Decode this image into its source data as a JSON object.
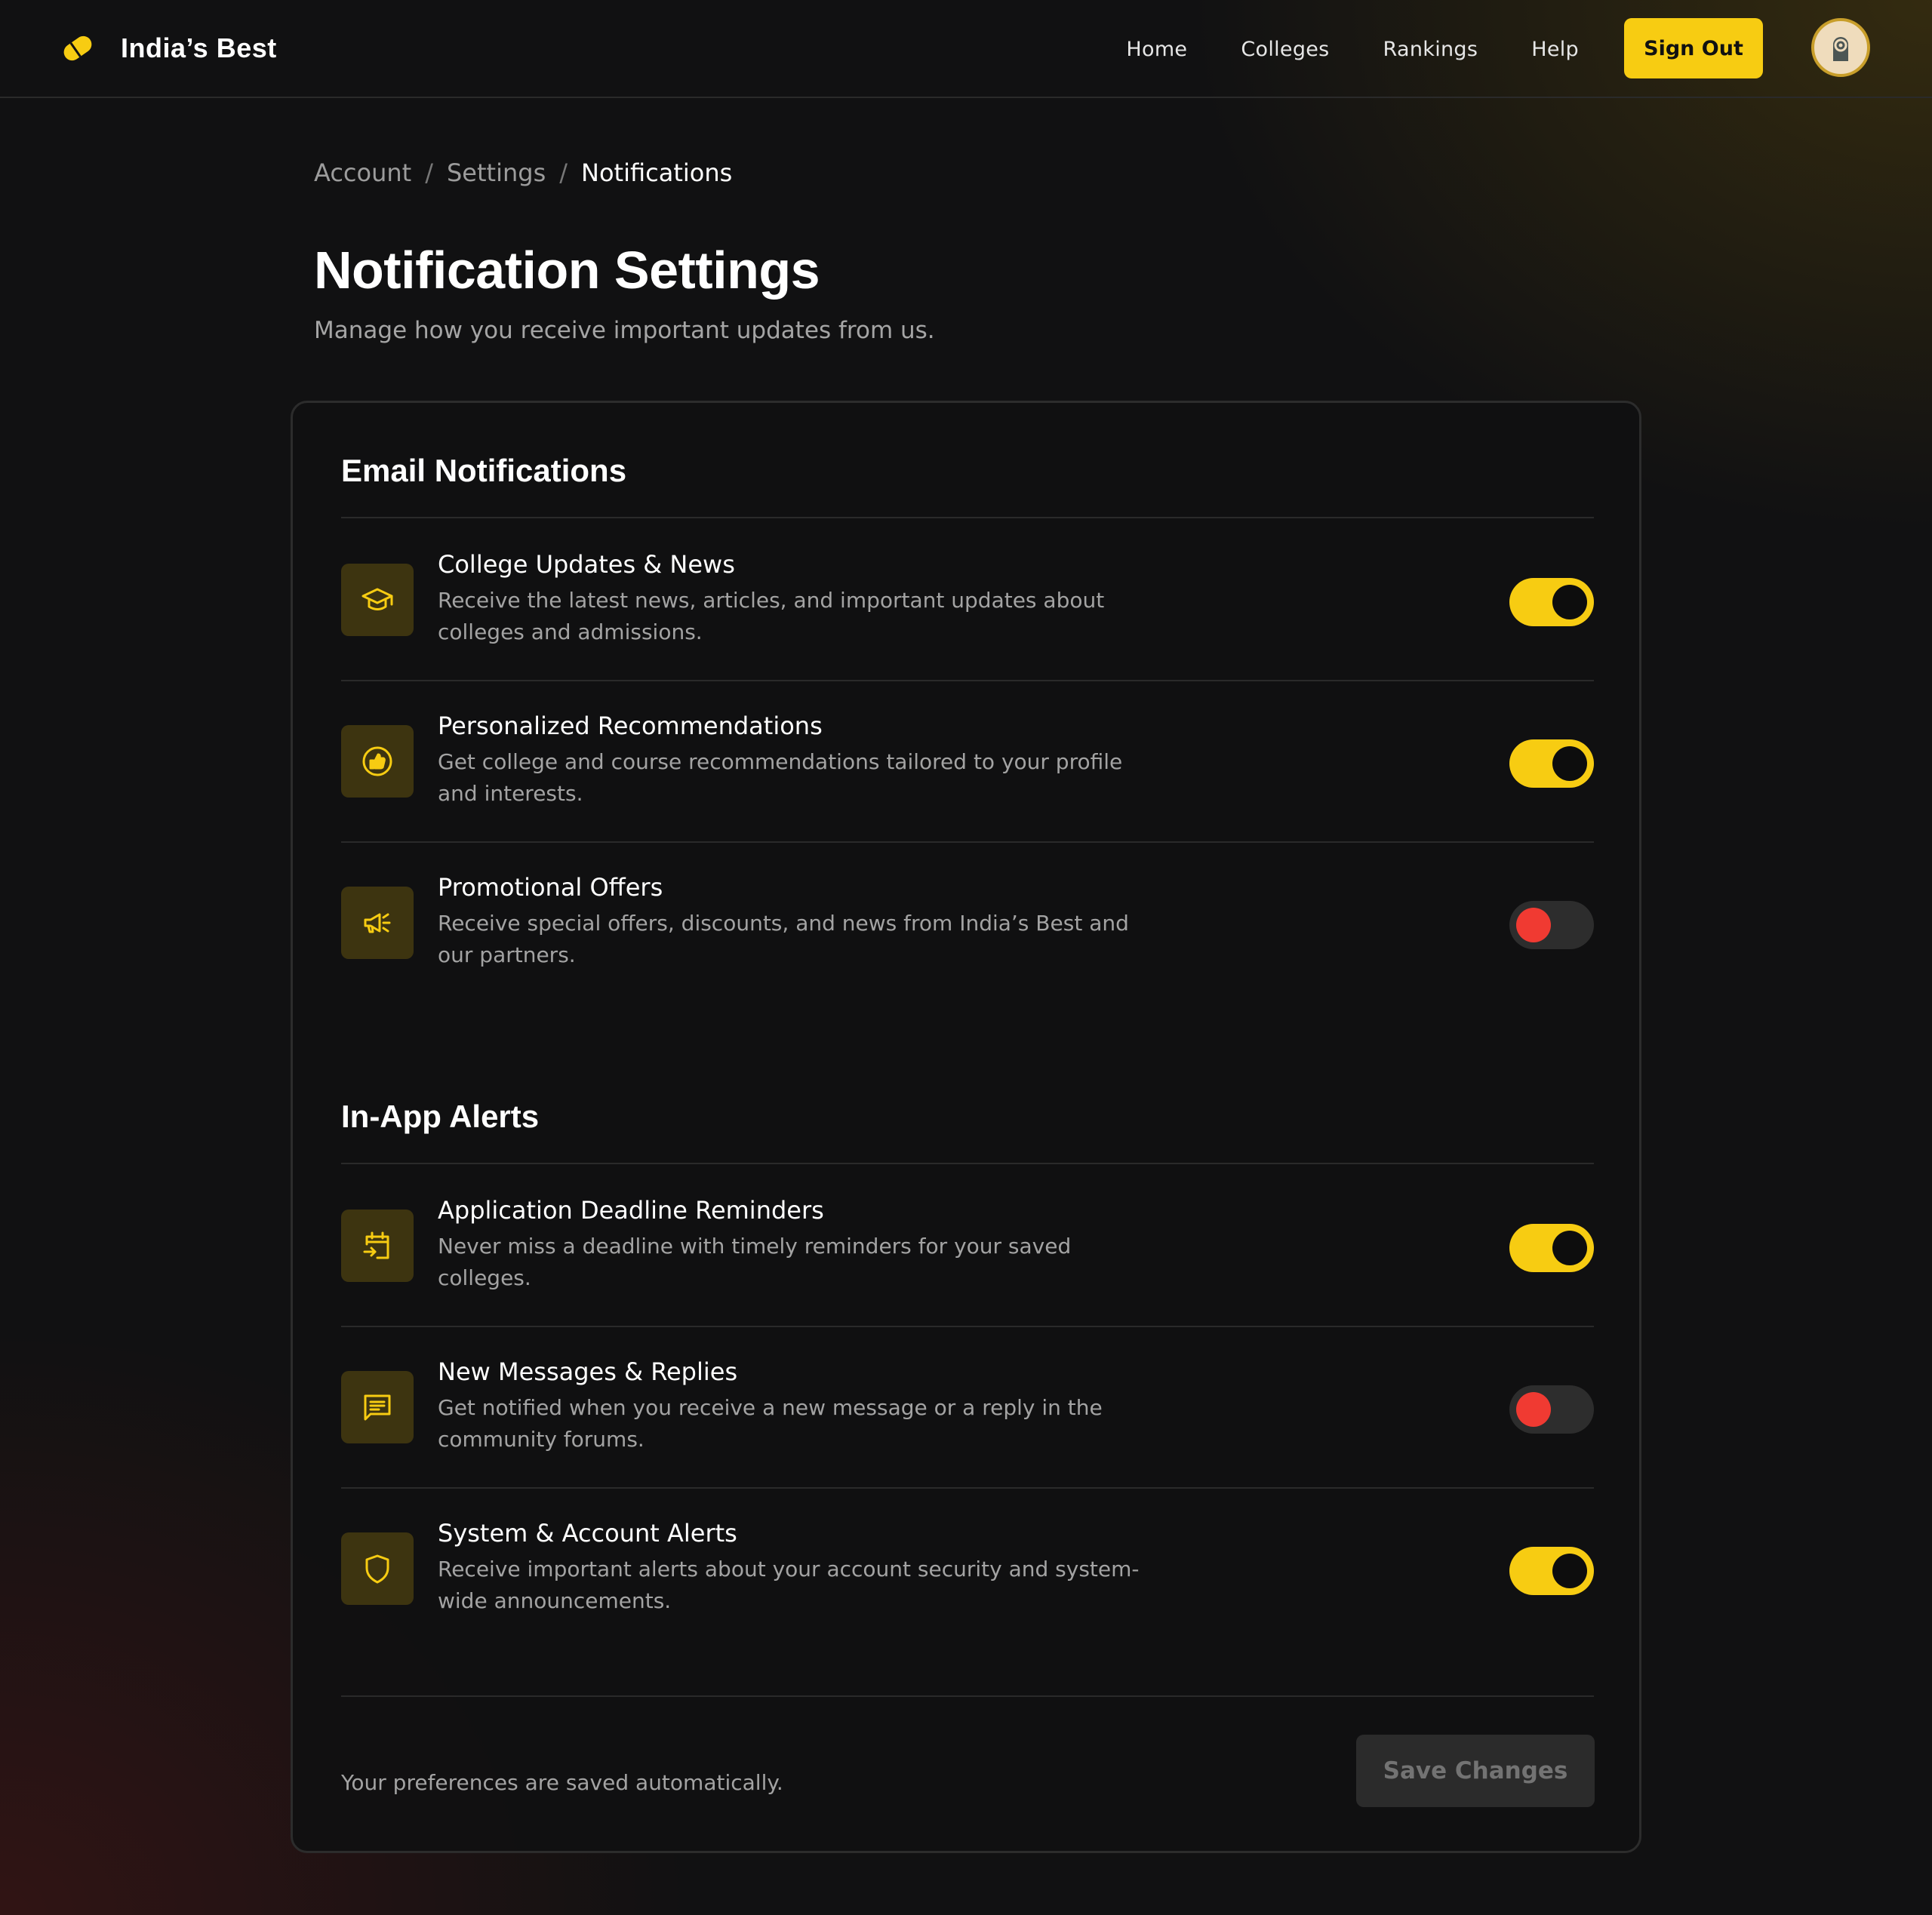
{
  "app": {
    "brand_name": "India’s Best",
    "brand_icon": "ticket-icon",
    "accent_color": "#f7cc12",
    "off_knob_color": "#f03a32"
  },
  "nav": {
    "links": [
      "Home",
      "Colleges",
      "Rankings",
      "Help"
    ],
    "sign_out_label": "Sign Out"
  },
  "breadcrumb": [
    "Account",
    "Settings",
    "Notifications"
  ],
  "page": {
    "title": "Notification Settings",
    "subtitle": "Manage how you receive important updates from us."
  },
  "sections": [
    {
      "title": "Email Notifications",
      "items": [
        {
          "icon": "graduation-cap-icon",
          "title": "College Updates & News",
          "description": "Receive the latest news, articles, and important updates about colleges and admissions.",
          "enabled": true
        },
        {
          "icon": "thumbs-up-icon",
          "title": "Personalized Recommendations",
          "description": "Get college and course recommendations tailored to your profile and interests.",
          "enabled": true
        },
        {
          "icon": "megaphone-icon",
          "title": "Promotional Offers",
          "description": "Receive special offers, discounts, and news from India’s Best and our partners.",
          "enabled": false
        }
      ]
    },
    {
      "title": "In-App Alerts",
      "items": [
        {
          "icon": "calendar-icon",
          "title": "Application Deadline Reminders",
          "description": "Never miss a deadline with timely reminders for your saved colleges.",
          "enabled": true
        },
        {
          "icon": "message-icon",
          "title": "New Messages & Replies",
          "description": "Get notified when you receive a new message or a reply in the community forums.",
          "enabled": false
        },
        {
          "icon": "shield-icon",
          "title": "System & Account Alerts",
          "description": "Receive important alerts about your account security and system-wide announcements.",
          "enabled": true
        }
      ]
    }
  ],
  "footer": {
    "note": "Your preferences are saved automatically.",
    "save_label": "Save Changes"
  }
}
